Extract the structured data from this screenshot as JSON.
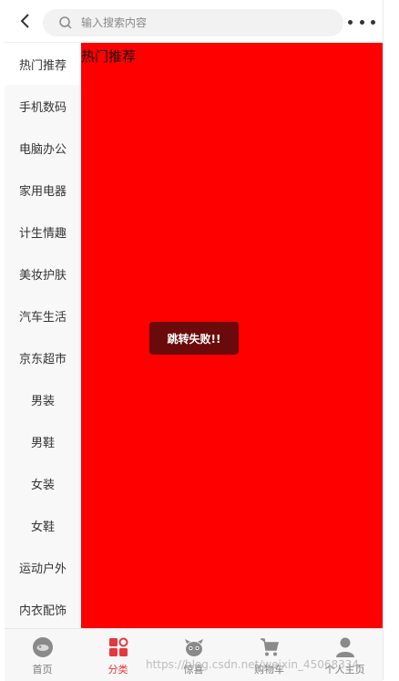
{
  "header": {
    "search_placeholder": "输入搜索内容"
  },
  "sidebar": {
    "items": [
      {
        "label": "热门推荐"
      },
      {
        "label": "手机数码"
      },
      {
        "label": "电脑办公"
      },
      {
        "label": "家用电器"
      },
      {
        "label": "计生情趣"
      },
      {
        "label": "美妆护肤"
      },
      {
        "label": "汽车生活"
      },
      {
        "label": "京东超市"
      },
      {
        "label": "男装"
      },
      {
        "label": "男鞋"
      },
      {
        "label": "女装"
      },
      {
        "label": "女鞋"
      },
      {
        "label": "运动户外"
      },
      {
        "label": "内衣配饰"
      }
    ],
    "active_index": 0
  },
  "content": {
    "title": "热门推荐",
    "background_color": "#ff0000",
    "toast": "跳转失败!!"
  },
  "tabbar": {
    "items": [
      {
        "label": "首页",
        "icon": "home-icon"
      },
      {
        "label": "分类",
        "icon": "category-icon"
      },
      {
        "label": "惊喜",
        "icon": "surprise-icon"
      },
      {
        "label": "购物车",
        "icon": "cart-icon"
      },
      {
        "label": "个人主页",
        "icon": "user-icon"
      }
    ],
    "active_index": 1,
    "active_color": "#e4393c"
  },
  "watermark": "https://blog.csdn.net/weixin_45068334"
}
